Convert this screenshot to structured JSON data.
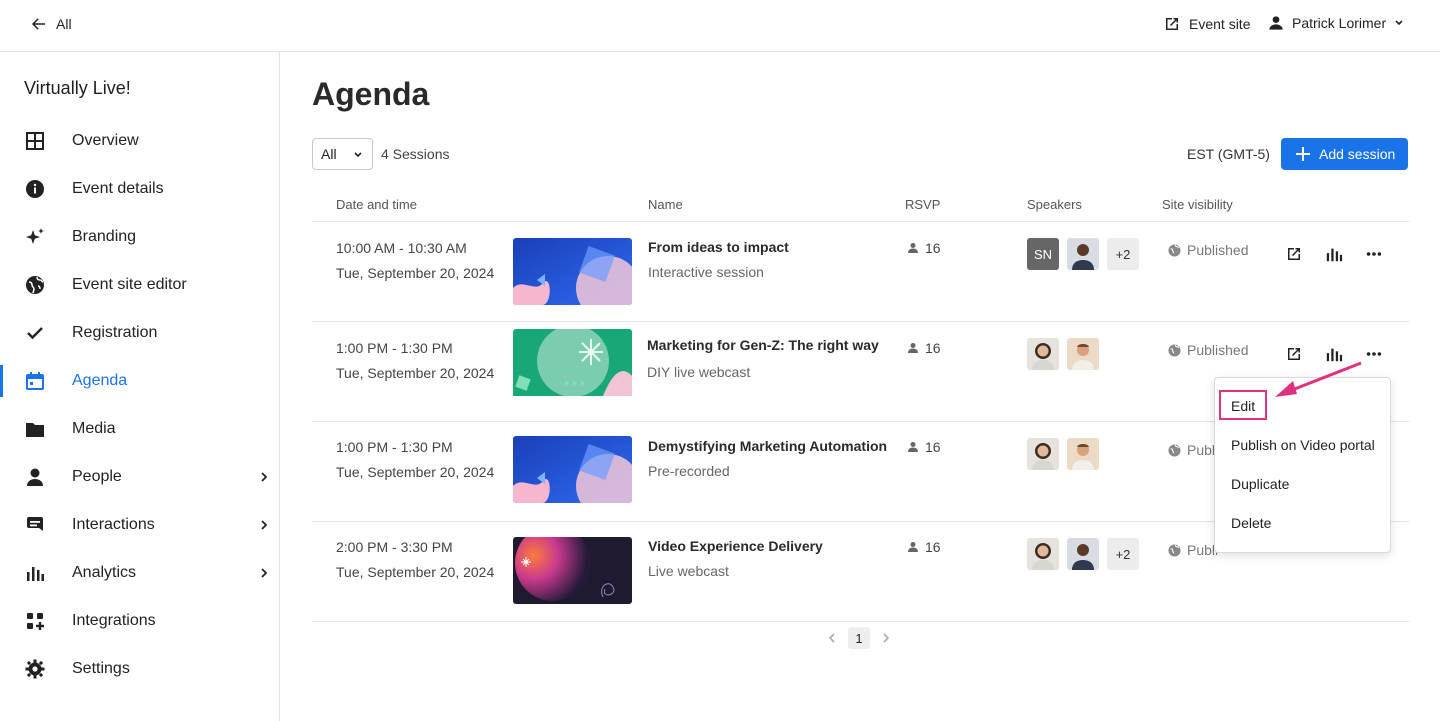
{
  "topbar": {
    "back_label": "All",
    "event_site_label": "Event site",
    "user_name": "Patrick Lorimer"
  },
  "sidebar": {
    "app_title": "Virtually Live!",
    "items": [
      {
        "label": "Overview",
        "icon": "grid-icon"
      },
      {
        "label": "Event details",
        "icon": "info-icon"
      },
      {
        "label": "Branding",
        "icon": "sparkle-icon"
      },
      {
        "label": "Event site editor",
        "icon": "globe-icon"
      },
      {
        "label": "Registration",
        "icon": "check-icon"
      },
      {
        "label": "Agenda",
        "icon": "calendar-icon",
        "active": true
      },
      {
        "label": "Media",
        "icon": "folder-icon"
      },
      {
        "label": "People",
        "icon": "person-icon",
        "has_submenu": true
      },
      {
        "label": "Interactions",
        "icon": "chat-icon",
        "has_submenu": true
      },
      {
        "label": "Analytics",
        "icon": "bar-chart-icon",
        "has_submenu": true
      },
      {
        "label": "Integrations",
        "icon": "integrations-icon"
      },
      {
        "label": "Settings",
        "icon": "gear-icon"
      }
    ]
  },
  "main": {
    "title": "Agenda",
    "filter_value": "All",
    "sessions_count": "4 Sessions",
    "timezone": "EST (GMT-5)",
    "add_session_label": "Add session",
    "columns": [
      "Date and time",
      "Name",
      "RSVP",
      "Speakers",
      "Site visibility"
    ],
    "rows": [
      {
        "time": "10:00 AM - 10:30 AM",
        "date": "Tue, September 20, 2024",
        "name": "From ideas to impact",
        "type": "Interactive session",
        "rsvp": "16",
        "speakers": [
          "SN",
          "avatar",
          "+2"
        ],
        "visibility": "Published"
      },
      {
        "time": "1:00 PM - 1:30 PM",
        "date": "Tue, September 20, 2024",
        "name": "Marketing for Gen-Z: The right way",
        "type": "DIY live webcast",
        "rsvp": "16",
        "speakers": [
          "avatar",
          "avatar"
        ],
        "visibility": "Published"
      },
      {
        "time": "1:00 PM - 1:30 PM",
        "date": "Tue, September 20, 2024",
        "name": "Demystifying Marketing Automation",
        "type": "Pre-recorded",
        "rsvp": "16",
        "speakers": [
          "avatar",
          "avatar"
        ],
        "visibility": "Publi"
      },
      {
        "time": "2:00 PM - 3:30 PM",
        "date": "Tue, September 20, 2024",
        "name": "Video Experience Delivery",
        "type": "Live webcast",
        "rsvp": "16",
        "speakers": [
          "avatar",
          "avatar",
          "+2"
        ],
        "visibility": "Publi"
      }
    ]
  },
  "context_menu": {
    "items": [
      "Edit",
      "Publish on Video portal",
      "Duplicate",
      "Delete"
    ]
  },
  "pagination": {
    "current_page": "1"
  },
  "colors": {
    "accent": "#1a73e8",
    "annotation": "#e0307e"
  }
}
